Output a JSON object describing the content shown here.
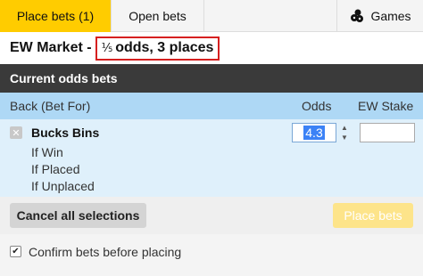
{
  "tabs": {
    "place_bets": "Place bets (1)",
    "open_bets": "Open bets",
    "games": "Games"
  },
  "market": {
    "prefix": "EW Market -",
    "fraction": "⅕",
    "terms": "odds, 3 places"
  },
  "section": {
    "title": "Current odds bets"
  },
  "columns": {
    "back": "Back (Bet For)",
    "odds": "Odds",
    "stake": "EW Stake"
  },
  "bet": {
    "remove_symbol": "✕",
    "runner": "Bucks Bins",
    "outcomes": [
      "If Win",
      "If Placed",
      "If Unplaced"
    ],
    "odds_value": "4.3",
    "stake_value": ""
  },
  "actions": {
    "cancel_label": "Cancel all selections",
    "place_label": "Place bets"
  },
  "confirm": {
    "label": "Confirm bets before placing",
    "checked": true,
    "check_symbol": "✔"
  },
  "colors": {
    "accent": "#ffcc00",
    "header_dark": "#3a3a3a",
    "column_header": "#aed8f5",
    "bet_row": "#dff0fb",
    "highlight_border": "#d62020",
    "place_disabled": "#fde48a"
  },
  "icons": {
    "games": "games-icon",
    "remove": "close-icon",
    "stepper_up": "caret-up-icon",
    "stepper_down": "caret-down-icon"
  }
}
